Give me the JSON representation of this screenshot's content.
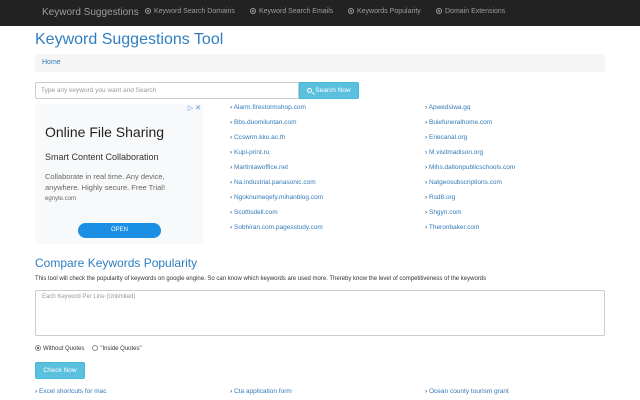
{
  "navbar": {
    "brand": "Keyword Suggestions",
    "items": [
      {
        "label": "Keyword Search Domains",
        "icon": "circle-icon"
      },
      {
        "label": "Keyword Search Emails",
        "icon": "circle-icon"
      },
      {
        "label": "Keywords Popularity",
        "icon": "circle-icon"
      },
      {
        "label": "Domain Extensions",
        "icon": "circle-icon"
      }
    ]
  },
  "page": {
    "title": "Keyword Suggestions Tool",
    "breadcrumb": "Home"
  },
  "search": {
    "placeholder": "Type any keyword you want and Search",
    "button_label": "Search Now"
  },
  "ad": {
    "title": "Online File Sharing",
    "subtitle": "Smart Content Collaboration",
    "text": "Collaborate in real time. Any device, anywhere. Highly secure. Free Trial!",
    "domain": "egnyte.com",
    "button_label": "OPEN",
    "icons": "▷ ✕"
  },
  "keywords": {
    "col1": [
      "Alarm.firestormshop.com",
      "Bbs.duomiluntan.com",
      "Ccswrm.kku.ac.th",
      "Kupi-print.ru",
      "Martinlawoffice.net",
      "Na.industrial.panasonic.com",
      "Ngoknumeqefy.mihanblog.com",
      "Scottisdell.com",
      "Sobhiran.com.pagesstudy.com"
    ],
    "col2": [
      "Apwedsiwa.gq",
      "Buiefuneralhome.com",
      "Eriecanal.org",
      "M.visitmadison.org",
      "Mihs.daltonpublicschools.com",
      "Natgeosubscriptions.com",
      "Rsd8.org",
      "Shgyn.com",
      "Theronbaker.com"
    ]
  },
  "compare": {
    "title": "Compare Keywords Popularity",
    "description": "This tool will check the popularity of keywords on google engine. So can know which keywords are used more. Thereby know the level of competitiveness of the keywords",
    "textarea_placeholder": "Each Keyword Per Line (Unlimited)",
    "radio_options": [
      {
        "label": "Without Quotes",
        "checked": true
      },
      {
        "label": "\"Inside Quotes\"",
        "checked": false
      }
    ],
    "button_label": "Check Now"
  },
  "bottom_links": [
    "Excel shortcuts for mac",
    "Cta application form",
    "Ocean county tourism grant"
  ],
  "colors": {
    "navbar": "#222222",
    "title": "#2f7ec1",
    "link": "#337ab7",
    "button": "#5bc0de",
    "ad_button": "#1a8fe3"
  }
}
